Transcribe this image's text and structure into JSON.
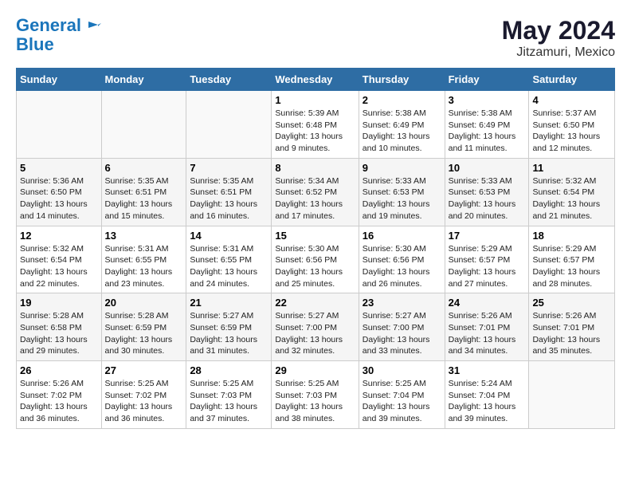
{
  "header": {
    "logo_line1": "General",
    "logo_line2": "Blue",
    "title": "May 2024",
    "subtitle": "Jitzamuri, Mexico"
  },
  "days_of_week": [
    "Sunday",
    "Monday",
    "Tuesday",
    "Wednesday",
    "Thursday",
    "Friday",
    "Saturday"
  ],
  "weeks": [
    [
      {
        "day": "",
        "info": ""
      },
      {
        "day": "",
        "info": ""
      },
      {
        "day": "",
        "info": ""
      },
      {
        "day": "1",
        "info": "Sunrise: 5:39 AM\nSunset: 6:48 PM\nDaylight: 13 hours\nand 9 minutes."
      },
      {
        "day": "2",
        "info": "Sunrise: 5:38 AM\nSunset: 6:49 PM\nDaylight: 13 hours\nand 10 minutes."
      },
      {
        "day": "3",
        "info": "Sunrise: 5:38 AM\nSunset: 6:49 PM\nDaylight: 13 hours\nand 11 minutes."
      },
      {
        "day": "4",
        "info": "Sunrise: 5:37 AM\nSunset: 6:50 PM\nDaylight: 13 hours\nand 12 minutes."
      }
    ],
    [
      {
        "day": "5",
        "info": "Sunrise: 5:36 AM\nSunset: 6:50 PM\nDaylight: 13 hours\nand 14 minutes."
      },
      {
        "day": "6",
        "info": "Sunrise: 5:35 AM\nSunset: 6:51 PM\nDaylight: 13 hours\nand 15 minutes."
      },
      {
        "day": "7",
        "info": "Sunrise: 5:35 AM\nSunset: 6:51 PM\nDaylight: 13 hours\nand 16 minutes."
      },
      {
        "day": "8",
        "info": "Sunrise: 5:34 AM\nSunset: 6:52 PM\nDaylight: 13 hours\nand 17 minutes."
      },
      {
        "day": "9",
        "info": "Sunrise: 5:33 AM\nSunset: 6:53 PM\nDaylight: 13 hours\nand 19 minutes."
      },
      {
        "day": "10",
        "info": "Sunrise: 5:33 AM\nSunset: 6:53 PM\nDaylight: 13 hours\nand 20 minutes."
      },
      {
        "day": "11",
        "info": "Sunrise: 5:32 AM\nSunset: 6:54 PM\nDaylight: 13 hours\nand 21 minutes."
      }
    ],
    [
      {
        "day": "12",
        "info": "Sunrise: 5:32 AM\nSunset: 6:54 PM\nDaylight: 13 hours\nand 22 minutes."
      },
      {
        "day": "13",
        "info": "Sunrise: 5:31 AM\nSunset: 6:55 PM\nDaylight: 13 hours\nand 23 minutes."
      },
      {
        "day": "14",
        "info": "Sunrise: 5:31 AM\nSunset: 6:55 PM\nDaylight: 13 hours\nand 24 minutes."
      },
      {
        "day": "15",
        "info": "Sunrise: 5:30 AM\nSunset: 6:56 PM\nDaylight: 13 hours\nand 25 minutes."
      },
      {
        "day": "16",
        "info": "Sunrise: 5:30 AM\nSunset: 6:56 PM\nDaylight: 13 hours\nand 26 minutes."
      },
      {
        "day": "17",
        "info": "Sunrise: 5:29 AM\nSunset: 6:57 PM\nDaylight: 13 hours\nand 27 minutes."
      },
      {
        "day": "18",
        "info": "Sunrise: 5:29 AM\nSunset: 6:57 PM\nDaylight: 13 hours\nand 28 minutes."
      }
    ],
    [
      {
        "day": "19",
        "info": "Sunrise: 5:28 AM\nSunset: 6:58 PM\nDaylight: 13 hours\nand 29 minutes."
      },
      {
        "day": "20",
        "info": "Sunrise: 5:28 AM\nSunset: 6:59 PM\nDaylight: 13 hours\nand 30 minutes."
      },
      {
        "day": "21",
        "info": "Sunrise: 5:27 AM\nSunset: 6:59 PM\nDaylight: 13 hours\nand 31 minutes."
      },
      {
        "day": "22",
        "info": "Sunrise: 5:27 AM\nSunset: 7:00 PM\nDaylight: 13 hours\nand 32 minutes."
      },
      {
        "day": "23",
        "info": "Sunrise: 5:27 AM\nSunset: 7:00 PM\nDaylight: 13 hours\nand 33 minutes."
      },
      {
        "day": "24",
        "info": "Sunrise: 5:26 AM\nSunset: 7:01 PM\nDaylight: 13 hours\nand 34 minutes."
      },
      {
        "day": "25",
        "info": "Sunrise: 5:26 AM\nSunset: 7:01 PM\nDaylight: 13 hours\nand 35 minutes."
      }
    ],
    [
      {
        "day": "26",
        "info": "Sunrise: 5:26 AM\nSunset: 7:02 PM\nDaylight: 13 hours\nand 36 minutes."
      },
      {
        "day": "27",
        "info": "Sunrise: 5:25 AM\nSunset: 7:02 PM\nDaylight: 13 hours\nand 36 minutes."
      },
      {
        "day": "28",
        "info": "Sunrise: 5:25 AM\nSunset: 7:03 PM\nDaylight: 13 hours\nand 37 minutes."
      },
      {
        "day": "29",
        "info": "Sunrise: 5:25 AM\nSunset: 7:03 PM\nDaylight: 13 hours\nand 38 minutes."
      },
      {
        "day": "30",
        "info": "Sunrise: 5:25 AM\nSunset: 7:04 PM\nDaylight: 13 hours\nand 39 minutes."
      },
      {
        "day": "31",
        "info": "Sunrise: 5:24 AM\nSunset: 7:04 PM\nDaylight: 13 hours\nand 39 minutes."
      },
      {
        "day": "",
        "info": ""
      }
    ]
  ]
}
